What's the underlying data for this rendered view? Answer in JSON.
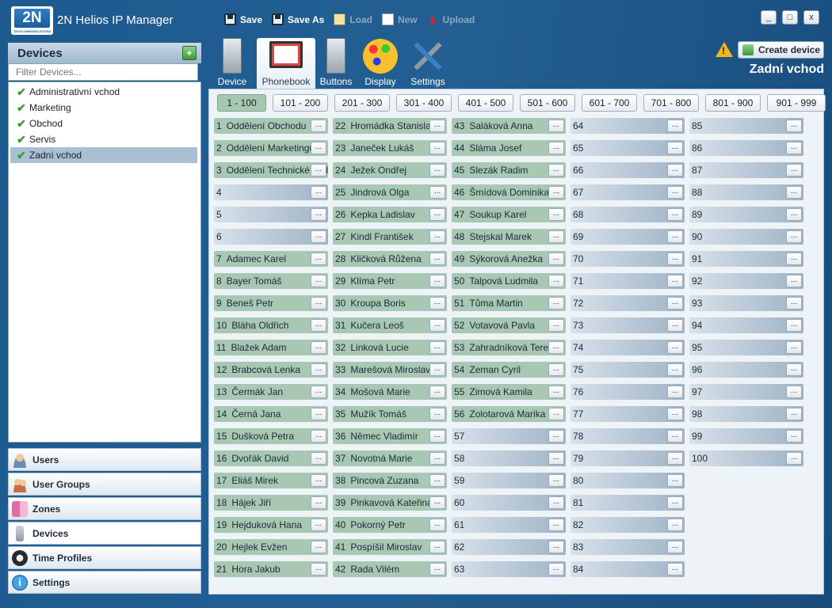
{
  "app": {
    "logo_text": "2N",
    "logo_sub": "TELECOMMUNICATIONS",
    "title": "2N Helios IP Manager"
  },
  "toolbar": {
    "save": "Save",
    "save_as": "Save As",
    "load": "Load",
    "new": "New",
    "upload": "Upload"
  },
  "window": {
    "minimize": "_",
    "maximize": "□",
    "close": "x"
  },
  "sidebar": {
    "header": "Devices",
    "filter_placeholder": "Filter Devices...",
    "devices": [
      "Administrativní vchod",
      "Marketing",
      "Obchod",
      "Servis",
      "Zadní vchod"
    ],
    "selected_device": "Zadní vchod",
    "nav": [
      "Users",
      "User Groups",
      "Zones",
      "Devices",
      "Time Profiles",
      "Settings"
    ],
    "active_nav": "Devices"
  },
  "tabs": [
    "Device",
    "Phonebook",
    "Buttons",
    "Display",
    "Settings"
  ],
  "active_tab": "Phonebook",
  "header_right": {
    "create_device": "Create device",
    "device_name": "Zadní vchod",
    "warning_icon": "warning-icon"
  },
  "ranges": [
    "1 - 100",
    "101 - 200",
    "201 - 300",
    "301 - 400",
    "401 - 500",
    "501 - 600",
    "601 - 700",
    "701 - 800",
    "801 - 900",
    "901 - 999"
  ],
  "active_range": "1 - 100",
  "phonebook": [
    {
      "n": "1",
      "name": "Oddělení Obchodu"
    },
    {
      "n": "2",
      "name": "Oddělení Marketingu"
    },
    {
      "n": "3",
      "name": "Oddělení Technické podpory"
    },
    {
      "n": "4",
      "name": ""
    },
    {
      "n": "5",
      "name": ""
    },
    {
      "n": "6",
      "name": ""
    },
    {
      "n": "7",
      "name": "Adamec Karel"
    },
    {
      "n": "8",
      "name": "Bayer Tomáš"
    },
    {
      "n": "9",
      "name": "Beneš Petr"
    },
    {
      "n": "10",
      "name": "Bláha Oldřich"
    },
    {
      "n": "11",
      "name": "Blažek Adam"
    },
    {
      "n": "12",
      "name": "Brabcová Lenka"
    },
    {
      "n": "13",
      "name": "Čermák Jan"
    },
    {
      "n": "14",
      "name": "Černá Jana"
    },
    {
      "n": "15",
      "name": "Dušková Petra"
    },
    {
      "n": "16",
      "name": "Dvořák David"
    },
    {
      "n": "17",
      "name": "Eliáš Mirek"
    },
    {
      "n": "18",
      "name": "Hájek Jiří"
    },
    {
      "n": "19",
      "name": "Hejduková Hana"
    },
    {
      "n": "20",
      "name": "Hejlek Evžen"
    },
    {
      "n": "21",
      "name": "Hora Jakub"
    },
    {
      "n": "22",
      "name": "Hromádka Stanislav"
    },
    {
      "n": "23",
      "name": "Janeček Lukáš"
    },
    {
      "n": "24",
      "name": "Ježek Ondřej"
    },
    {
      "n": "25",
      "name": "Jindrová Olga"
    },
    {
      "n": "26",
      "name": "Kepka Ladislav"
    },
    {
      "n": "27",
      "name": "Kindl František"
    },
    {
      "n": "28",
      "name": "Kličková Růžena"
    },
    {
      "n": "29",
      "name": "Klíma Petr"
    },
    {
      "n": "30",
      "name": "Kroupa Boris"
    },
    {
      "n": "31",
      "name": "Kučera Leoš"
    },
    {
      "n": "32",
      "name": "Linková Lucie"
    },
    {
      "n": "33",
      "name": "Marešová Miroslava"
    },
    {
      "n": "34",
      "name": "Mošová Marie"
    },
    {
      "n": "35",
      "name": "Mužík Tomáš"
    },
    {
      "n": "36",
      "name": "Němec Vladimír"
    },
    {
      "n": "37",
      "name": "Novotná Marie"
    },
    {
      "n": "38",
      "name": "Pincová Zuzana"
    },
    {
      "n": "39",
      "name": "Pinkavová Kateřina"
    },
    {
      "n": "40",
      "name": "Pokorný Petr"
    },
    {
      "n": "41",
      "name": "Pospíšil Miroslav"
    },
    {
      "n": "42",
      "name": "Rada Vilém"
    },
    {
      "n": "43",
      "name": "Saláková Anna"
    },
    {
      "n": "44",
      "name": "Sláma Josef"
    },
    {
      "n": "45",
      "name": "Slezák Radim"
    },
    {
      "n": "46",
      "name": "Šmídová Dominika"
    },
    {
      "n": "47",
      "name": "Soukup Karel"
    },
    {
      "n": "48",
      "name": "Stejskal Marek"
    },
    {
      "n": "49",
      "name": "Sýkorová Anežka"
    },
    {
      "n": "50",
      "name": "Talpová Ludmila"
    },
    {
      "n": "51",
      "name": "Tůma Martin"
    },
    {
      "n": "52",
      "name": "Votavová Pavla"
    },
    {
      "n": "53",
      "name": "Zahradníková Tereza"
    },
    {
      "n": "54",
      "name": "Zeman Cyril"
    },
    {
      "n": "55",
      "name": "Zimová Kamila"
    },
    {
      "n": "56",
      "name": "Zolotarová Marika"
    },
    {
      "n": "57",
      "name": ""
    },
    {
      "n": "58",
      "name": ""
    },
    {
      "n": "59",
      "name": ""
    },
    {
      "n": "60",
      "name": ""
    },
    {
      "n": "61",
      "name": ""
    },
    {
      "n": "62",
      "name": ""
    },
    {
      "n": "63",
      "name": ""
    },
    {
      "n": "64",
      "name": ""
    },
    {
      "n": "65",
      "name": ""
    },
    {
      "n": "66",
      "name": ""
    },
    {
      "n": "67",
      "name": ""
    },
    {
      "n": "68",
      "name": ""
    },
    {
      "n": "69",
      "name": ""
    },
    {
      "n": "70",
      "name": ""
    },
    {
      "n": "71",
      "name": ""
    },
    {
      "n": "72",
      "name": ""
    },
    {
      "n": "73",
      "name": ""
    },
    {
      "n": "74",
      "name": ""
    },
    {
      "n": "75",
      "name": ""
    },
    {
      "n": "76",
      "name": ""
    },
    {
      "n": "77",
      "name": ""
    },
    {
      "n": "78",
      "name": ""
    },
    {
      "n": "79",
      "name": ""
    },
    {
      "n": "80",
      "name": ""
    },
    {
      "n": "81",
      "name": ""
    },
    {
      "n": "82",
      "name": ""
    },
    {
      "n": "83",
      "name": ""
    },
    {
      "n": "84",
      "name": ""
    },
    {
      "n": "85",
      "name": ""
    },
    {
      "n": "86",
      "name": ""
    },
    {
      "n": "87",
      "name": ""
    },
    {
      "n": "88",
      "name": ""
    },
    {
      "n": "89",
      "name": ""
    },
    {
      "n": "90",
      "name": ""
    },
    {
      "n": "91",
      "name": ""
    },
    {
      "n": "92",
      "name": ""
    },
    {
      "n": "93",
      "name": ""
    },
    {
      "n": "94",
      "name": ""
    },
    {
      "n": "95",
      "name": ""
    },
    {
      "n": "96",
      "name": ""
    },
    {
      "n": "97",
      "name": ""
    },
    {
      "n": "98",
      "name": ""
    },
    {
      "n": "99",
      "name": ""
    },
    {
      "n": "100",
      "name": ""
    }
  ],
  "button_label": "..."
}
